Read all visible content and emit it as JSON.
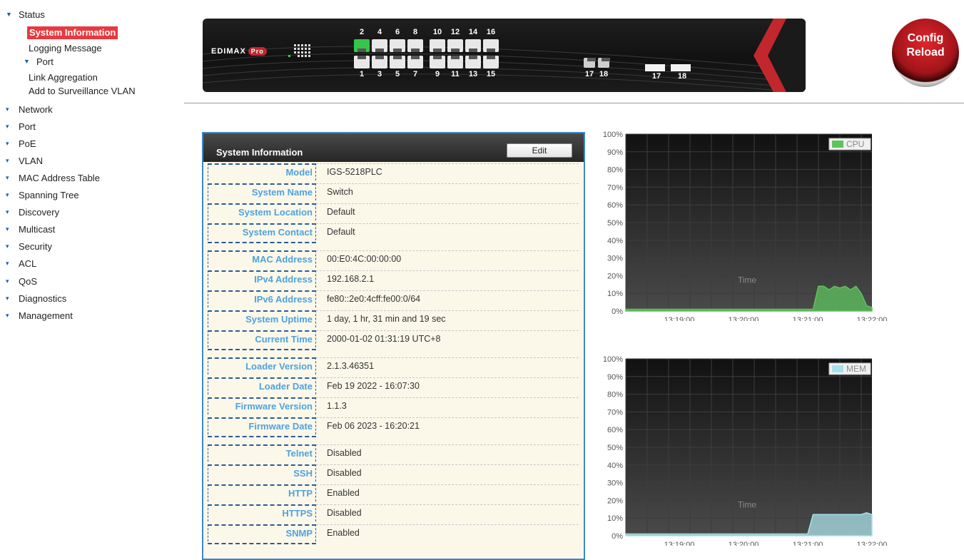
{
  "sidebar": {
    "status": "Status",
    "system_information": "System Information",
    "logging_message": "Logging Message",
    "port": "Port",
    "link_aggregation": "Link Aggregation",
    "add_surveillance": "Add to Surveillance VLAN",
    "items": [
      "Network",
      "Port",
      "PoE",
      "VLAN",
      "MAC Address Table",
      "Spanning Tree",
      "Discovery",
      "Multicast",
      "Security",
      "ACL",
      "QoS",
      "Diagnostics",
      "Management"
    ]
  },
  "banner": {
    "logo": "EDIMAX",
    "logo_badge": "Pro",
    "top_ports": [
      "2",
      "4",
      "6",
      "8",
      "10",
      "12",
      "14",
      "16"
    ],
    "bottom_ports": [
      "1",
      "3",
      "5",
      "7",
      "9",
      "11",
      "13",
      "15"
    ],
    "uplink_ports": [
      "17",
      "18"
    ],
    "sfp_ports": [
      "17",
      "18"
    ],
    "port_up": "2"
  },
  "config_reload": {
    "line1": "Config",
    "line2": "Reload"
  },
  "panel": {
    "title": "System Information",
    "edit_label": "Edit",
    "rows": [
      {
        "label": "Model",
        "value": "IGS-5218PLC"
      },
      {
        "label": "System Name",
        "value": "Switch"
      },
      {
        "label": "System Location",
        "value": "Default"
      },
      {
        "label": "System Contact",
        "value": "Default"
      },
      {
        "label": "MAC Address",
        "value": "00:E0:4C:00:00:00"
      },
      {
        "label": "IPv4 Address",
        "value": "192.168.2.1"
      },
      {
        "label": "IPv6 Address",
        "value": "fe80::2e0:4cff:fe00:0/64"
      },
      {
        "label": "System Uptime",
        "value": "1 day, 1 hr, 31 min and 19 sec"
      },
      {
        "label": "Current Time",
        "value": "2000-01-02 01:31:19 UTC+8"
      },
      {
        "label": "Loader Version",
        "value": "2.1.3.46351"
      },
      {
        "label": "Loader Date",
        "value": "Feb 19 2022 - 16:07:30"
      },
      {
        "label": "Firmware Version",
        "value": "1.1.3"
      },
      {
        "label": "Firmware Date",
        "value": "Feb 06 2023 - 16:20:21"
      },
      {
        "label": "Telnet",
        "value": "Disabled"
      },
      {
        "label": "SSH",
        "value": "Disabled"
      },
      {
        "label": "HTTP",
        "value": "Enabled"
      },
      {
        "label": "HTTPS",
        "value": "Disabled"
      },
      {
        "label": "SNMP",
        "value": "Enabled"
      }
    ]
  },
  "chart_data": [
    {
      "type": "area",
      "series": [
        {
          "name": "CPU",
          "color": "#5ec35e",
          "x": [
            "13:18:10",
            "13:21:00",
            "13:21:05",
            "13:21:10",
            "13:21:15",
            "13:21:20",
            "13:21:25",
            "13:21:30",
            "13:21:35",
            "13:21:40",
            "13:21:45",
            "13:21:50",
            "13:21:55",
            "13:22:00"
          ],
          "values": [
            1,
            1,
            1,
            14,
            14,
            12,
            14,
            13,
            14,
            12,
            14,
            10,
            3,
            2
          ]
        }
      ],
      "xlabel": "Time",
      "x_ticks": [
        "13:19:00",
        "13:20:00",
        "13:21:00",
        "13:22:00"
      ],
      "y_ticks": [
        "0%",
        "10%",
        "20%",
        "30%",
        "40%",
        "50%",
        "60%",
        "70%",
        "80%",
        "90%",
        "100%"
      ],
      "ylim": [
        0,
        100
      ],
      "grid": true,
      "legend": "top-right"
    },
    {
      "type": "area",
      "series": [
        {
          "name": "MEM",
          "color": "#a9e1ea",
          "x": [
            "13:18:10",
            "13:20:55",
            "13:21:00",
            "13:21:05",
            "13:21:40",
            "13:21:50",
            "13:21:55",
            "13:22:00"
          ],
          "values": [
            1,
            1,
            1,
            12,
            12,
            12,
            13,
            12
          ]
        }
      ],
      "xlabel": "Time",
      "x_ticks": [
        "13:19:00",
        "13:20:00",
        "13:21:00",
        "13:22:00"
      ],
      "y_ticks": [
        "0%",
        "10%",
        "20%",
        "30%",
        "40%",
        "50%",
        "60%",
        "70%",
        "80%",
        "90%",
        "100%"
      ],
      "ylim": [
        0,
        100
      ],
      "grid": true,
      "legend": "top-right"
    }
  ]
}
